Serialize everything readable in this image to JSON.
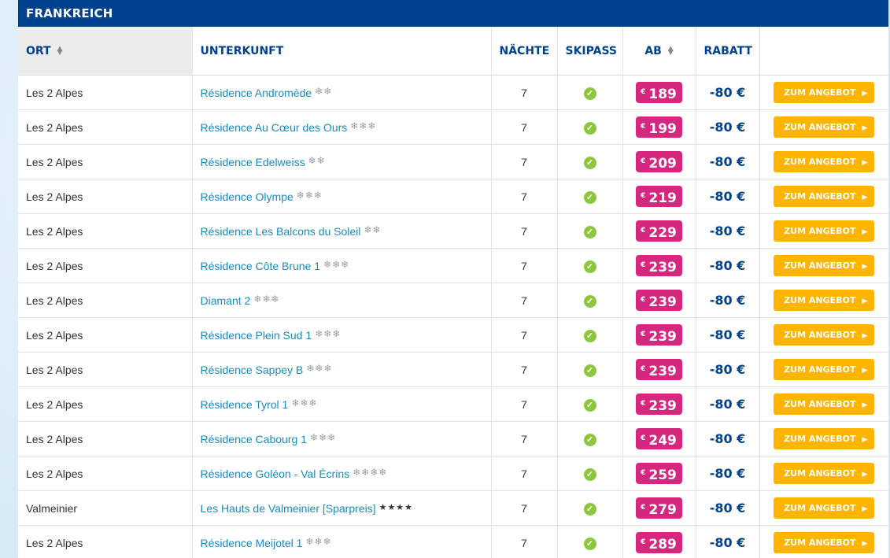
{
  "region": "FRANKREICH",
  "colors": {
    "header_bg": "#00418e",
    "price_bg": "#d6277f",
    "offer_bg": "#ffb400",
    "check": "#8dc63f",
    "link": "#1a8bbf"
  },
  "headers": {
    "ort": "ORT",
    "unterkunft": "UNTERKUNFT",
    "naechte": "NÄCHTE",
    "skipass": "SKIPASS",
    "ab": "AB",
    "rabatt": "RABATT"
  },
  "currency": "€",
  "offer_label": "ZUM ANGEBOT",
  "rows": [
    {
      "ort": "Les 2 Alpes",
      "unterkunft": "Résidence Andromède",
      "stars": "❄❄",
      "star_type": "flake",
      "naechte": "7",
      "price": "189",
      "rabatt": "-80 €"
    },
    {
      "ort": "Les 2 Alpes",
      "unterkunft": "Résidence Au Cœur des Ours",
      "stars": "❄❄❄",
      "star_type": "flake",
      "naechte": "7",
      "price": "199",
      "rabatt": "-80 €"
    },
    {
      "ort": "Les 2 Alpes",
      "unterkunft": "Résidence Edelweiss",
      "stars": "❄❄",
      "star_type": "flake",
      "naechte": "7",
      "price": "209",
      "rabatt": "-80 €"
    },
    {
      "ort": "Les 2 Alpes",
      "unterkunft": "Résidence Olympe",
      "stars": "❄❄❄",
      "star_type": "flake",
      "naechte": "7",
      "price": "219",
      "rabatt": "-80 €"
    },
    {
      "ort": "Les 2 Alpes",
      "unterkunft": "Résidence Les Balcons du Soleil",
      "stars": "❄❄",
      "star_type": "flake",
      "naechte": "7",
      "price": "229",
      "rabatt": "-80 €"
    },
    {
      "ort": "Les 2 Alpes",
      "unterkunft": "Résidence Côte Brune 1",
      "stars": "❄❄❄",
      "star_type": "flake",
      "naechte": "7",
      "price": "239",
      "rabatt": "-80 €"
    },
    {
      "ort": "Les 2 Alpes",
      "unterkunft": "Diamant 2",
      "stars": "❄❄❄",
      "star_type": "flake",
      "naechte": "7",
      "price": "239",
      "rabatt": "-80 €"
    },
    {
      "ort": "Les 2 Alpes",
      "unterkunft": "Résidence Plein Sud 1",
      "stars": "❄❄❄",
      "star_type": "flake",
      "naechte": "7",
      "price": "239",
      "rabatt": "-80 €"
    },
    {
      "ort": "Les 2 Alpes",
      "unterkunft": "Résidence Sappey B",
      "stars": "❄❄❄",
      "star_type": "flake",
      "naechte": "7",
      "price": "239",
      "rabatt": "-80 €"
    },
    {
      "ort": "Les 2 Alpes",
      "unterkunft": "Résidence Tyrol 1",
      "stars": "❄❄❄",
      "star_type": "flake",
      "naechte": "7",
      "price": "239",
      "rabatt": "-80 €"
    },
    {
      "ort": "Les 2 Alpes",
      "unterkunft": "Résidence Cabourg 1",
      "stars": "❄❄❄",
      "star_type": "flake",
      "naechte": "7",
      "price": "249",
      "rabatt": "-80 €"
    },
    {
      "ort": "Les 2 Alpes",
      "unterkunft": "Résidence Goléon - Val Écrins",
      "stars": "❄❄❄❄",
      "star_type": "flake",
      "naechte": "7",
      "price": "259",
      "rabatt": "-80 €"
    },
    {
      "ort": "Valmeinier",
      "unterkunft": "Les Hauts de Valmeinier [Sparpreis]",
      "stars": "★★★★",
      "star_type": "star",
      "naechte": "7",
      "price": "279",
      "rabatt": "-80 €"
    },
    {
      "ort": "Les 2 Alpes",
      "unterkunft": "Résidence Meijotel 1",
      "stars": "❄❄❄",
      "star_type": "flake",
      "naechte": "7",
      "price": "289",
      "rabatt": "-80 €"
    }
  ]
}
